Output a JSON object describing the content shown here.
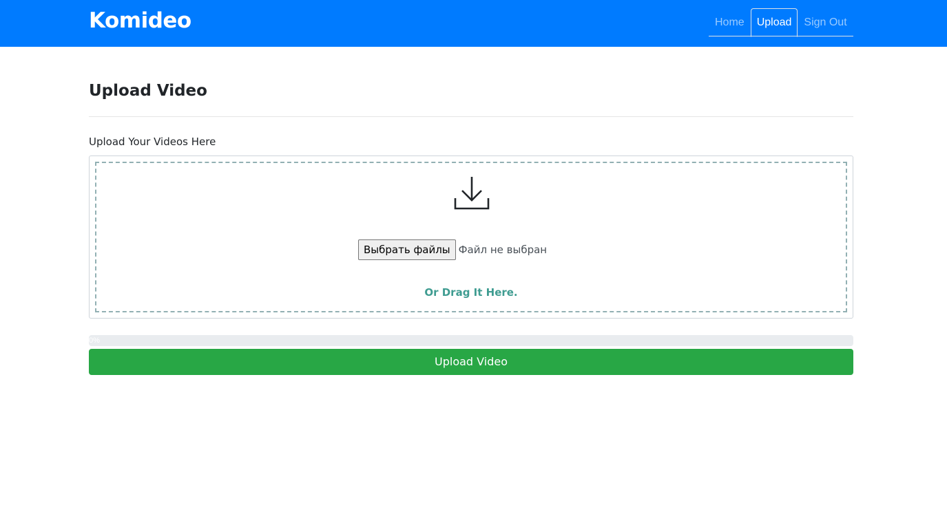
{
  "navbar": {
    "brand": "Komideo",
    "links": [
      {
        "label": "Home",
        "active": false
      },
      {
        "label": "Upload",
        "active": true
      },
      {
        "label": "Sign Out",
        "active": false
      }
    ]
  },
  "main": {
    "title": "Upload Video",
    "section_label": "Upload Your Videos Here"
  },
  "dropzone": {
    "icon": "download-icon",
    "file_button_label": "Выбрать файлы",
    "file_status": "Файл не выбран",
    "drag_text": "Or Drag It Here."
  },
  "progress": {
    "value": 0,
    "label": "0%"
  },
  "upload_button_label": "Upload Video",
  "colors": {
    "navbar": "#007bff",
    "drag_text": "#3f9c91",
    "dashed_border": "#92b0b3",
    "upload_button": "#28a745",
    "progress_track": "#e9ecef"
  }
}
